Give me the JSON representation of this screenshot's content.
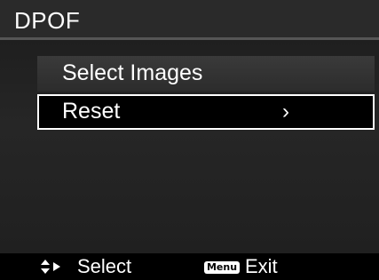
{
  "header": {
    "title": "DPOF"
  },
  "menu": {
    "items": [
      {
        "label": "Select Images",
        "selected": false
      },
      {
        "label": "Reset",
        "selected": true,
        "chevron": "›"
      }
    ]
  },
  "footer": {
    "select_icon": "up-down-arrows-icon",
    "select_label": "Select",
    "menu_key": "Menu",
    "exit_label": "Exit"
  },
  "colors": {
    "background": "#000000",
    "titlebar": "#2a2a2a",
    "selection_border": "#ffffff",
    "text": "#ffffff"
  }
}
